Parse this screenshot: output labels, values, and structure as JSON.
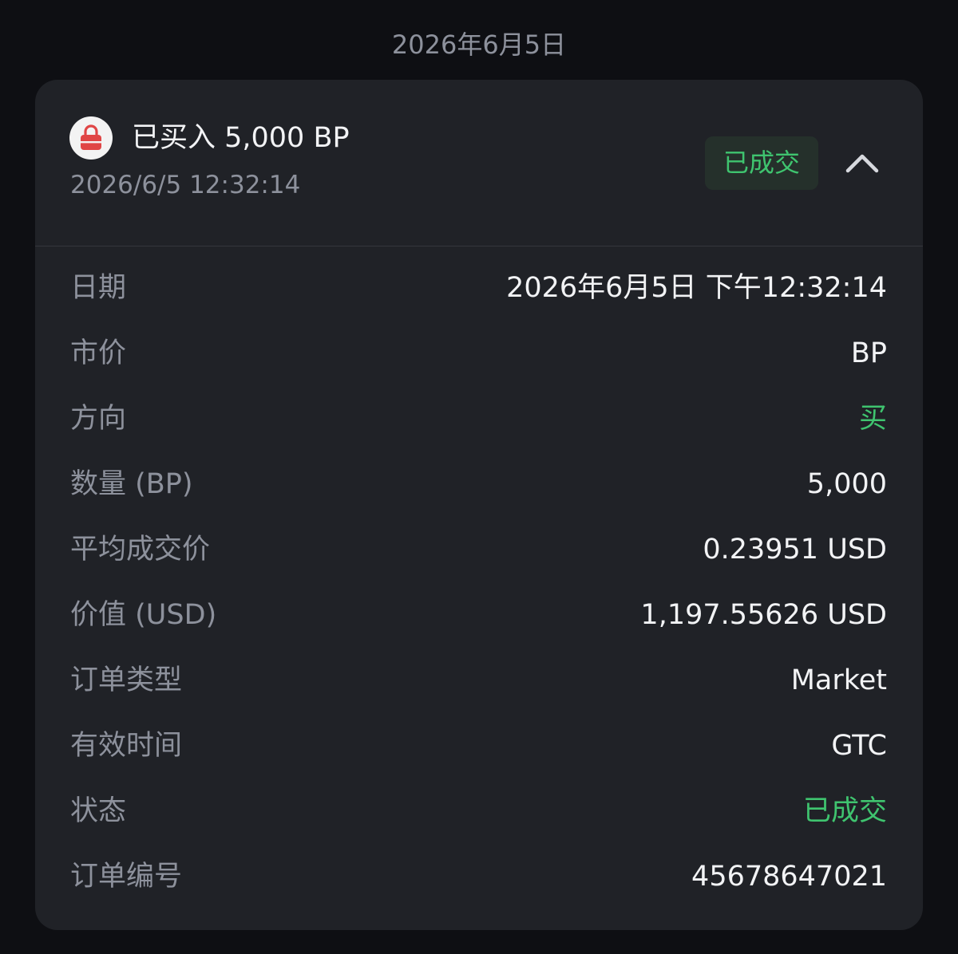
{
  "date_header": "2026年6月5日",
  "summary": {
    "title": "已买入 5,000 BP",
    "timestamp": "2026/6/5 12:32:14",
    "status_badge": "已成交",
    "avatar_icon": "padlock-icon"
  },
  "colors": {
    "accent_green": "#3fc46f",
    "avatar_red": "#e04646",
    "card_bg": "#202227",
    "page_bg": "#0e0f13"
  },
  "details": {
    "date": {
      "label": "日期",
      "value": "2026年6月5日 下午12:32:14"
    },
    "market": {
      "label": "市价",
      "value": "BP"
    },
    "side": {
      "label": "方向",
      "value": "买"
    },
    "quantity": {
      "label": "数量 (BP)",
      "value": "5,000"
    },
    "avg_price": {
      "label": "平均成交价",
      "value": "0.23951 USD"
    },
    "total_value": {
      "label": "价值 (USD)",
      "value": "1,197.55626 USD"
    },
    "order_type": {
      "label": "订单类型",
      "value": "Market"
    },
    "time_in_force": {
      "label": "有效时间",
      "value": "GTC"
    },
    "status": {
      "label": "状态",
      "value": "已成交"
    },
    "order_id": {
      "label": "订单编号",
      "value": "45678647021"
    }
  }
}
